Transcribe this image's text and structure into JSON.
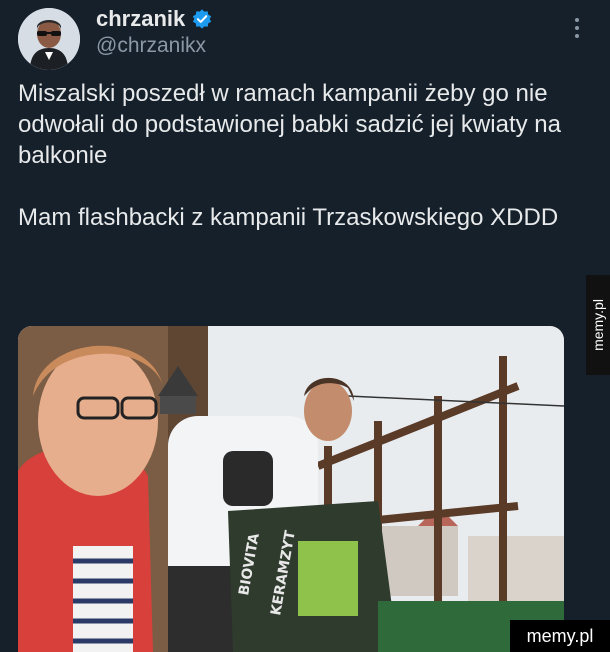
{
  "tweet": {
    "display_name": "chrzanik",
    "handle": "@chrzanikx",
    "paragraph1": "Miszalski poszedł w ramach kampanii żeby go nie odwołali do podstawionej babki sadzić jej kwiaty na balkonie",
    "paragraph2": "Mam flashbacki z kampanii Trzaskowskiego XDDD",
    "verified_color": "#1d9bf0"
  },
  "photo": {
    "bag_brand": "BIOVITA",
    "bag_product": "KERAMZYT"
  },
  "watermark": {
    "side": "memy.pl",
    "corner": "memy.pl"
  }
}
